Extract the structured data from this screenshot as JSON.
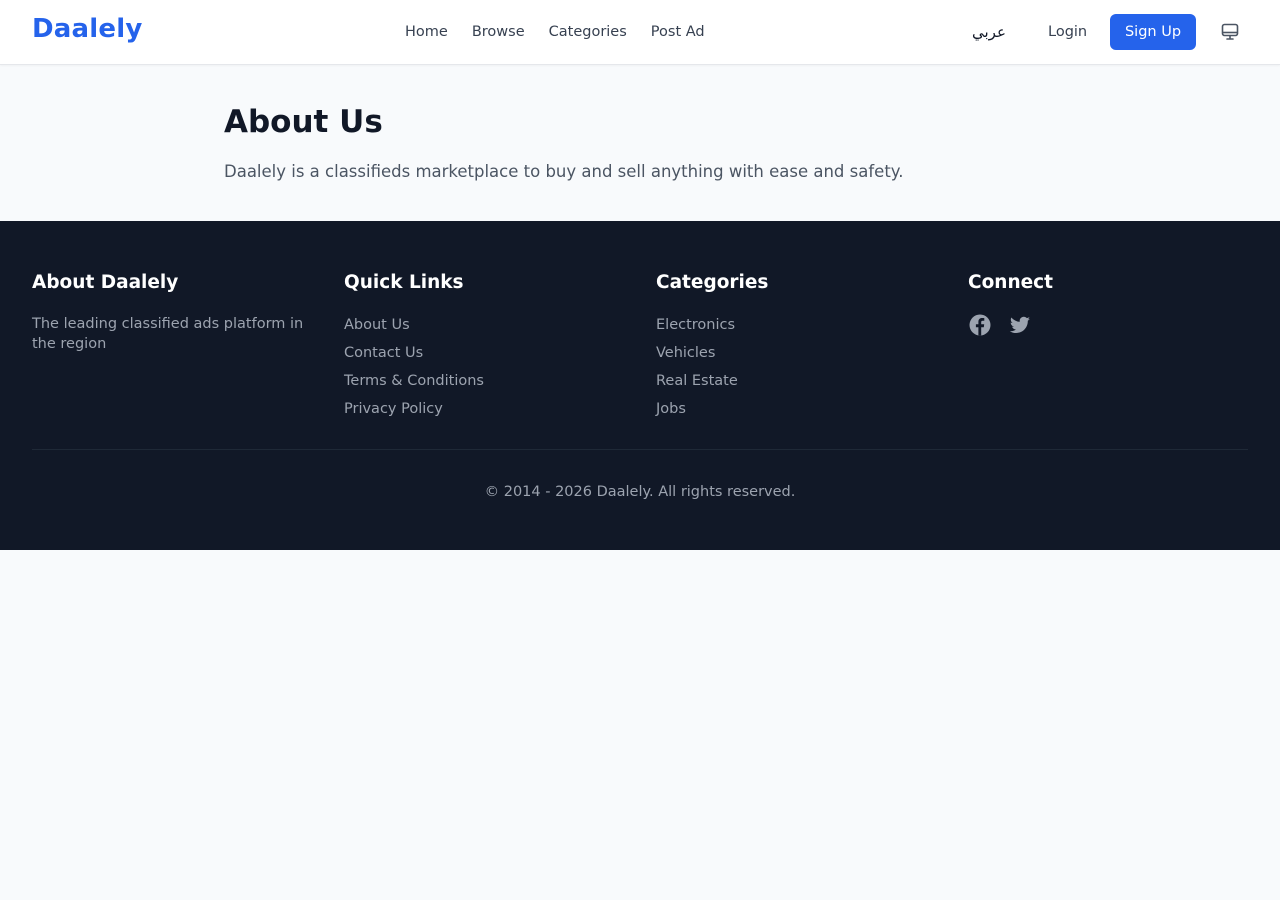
{
  "header": {
    "logo": "Daalely",
    "nav": [
      "Home",
      "Browse",
      "Categories",
      "Post Ad"
    ],
    "language": "عربي",
    "login": "Login",
    "signup": "Sign Up",
    "theme_icon": "monitor-icon"
  },
  "main": {
    "title": "About Us",
    "description": "Daalely is a classifieds marketplace to buy and sell anything with ease and safety."
  },
  "footer": {
    "about": {
      "heading": "About Daalely",
      "text": "The leading classified ads platform in the region"
    },
    "quick_links": {
      "heading": "Quick Links",
      "items": [
        "About Us",
        "Contact Us",
        "Terms & Conditions",
        "Privacy Policy"
      ]
    },
    "categories": {
      "heading": "Categories",
      "items": [
        "Electronics",
        "Vehicles",
        "Real Estate",
        "Jobs"
      ]
    },
    "connect": {
      "heading": "Connect",
      "icons": [
        "facebook-icon",
        "twitter-icon"
      ]
    },
    "copyright": "© 2014 - 2026 Daalely. All rights reserved."
  },
  "colors": {
    "brand": "#2563eb",
    "footer_bg": "#111827",
    "page_bg": "#f8fafc"
  }
}
